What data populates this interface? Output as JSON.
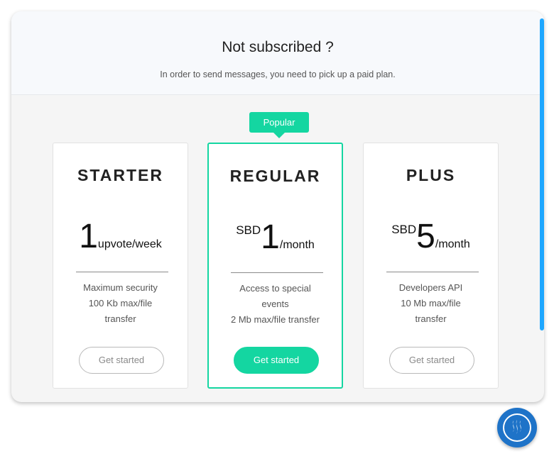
{
  "header": {
    "title": "Not subscribed ?",
    "subtitle": "In order to send messages, you need to pick up a paid plan."
  },
  "badge": {
    "label": "Popular"
  },
  "plans": [
    {
      "name": "STARTER",
      "currency": "",
      "amount": "1",
      "period": "upvote/week",
      "features": [
        "Maximum security",
        "100 Kb max/file",
        "transfer"
      ],
      "button": "Get started"
    },
    {
      "name": "REGULAR",
      "currency": "SBD",
      "amount": "1",
      "period": "/month",
      "features": [
        "Access to special",
        "events",
        "2 Mb max/file transfer"
      ],
      "button": "Get started"
    },
    {
      "name": "PLUS",
      "currency": "SBD",
      "amount": "5",
      "period": "/month",
      "features": [
        "Developers API",
        "10 Mb max/file",
        "transfer"
      ],
      "button": "Get started"
    }
  ],
  "colors": {
    "accent": "#14d6a1",
    "scrollbar": "#1ea7ff",
    "chat_button": "#1e73c8"
  },
  "icons": {
    "chat": "steem-logo-icon"
  }
}
